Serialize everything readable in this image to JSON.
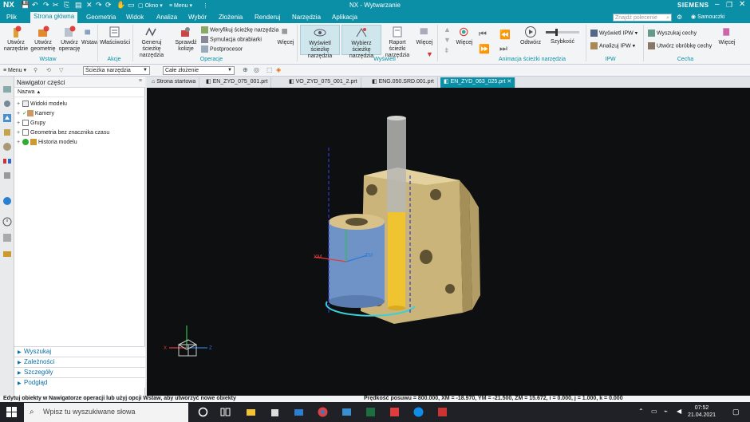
{
  "titlebar": {
    "logo": "NX",
    "title": "NX - Wytwarzanie",
    "window_menu": "Okno",
    "menu": "Menu",
    "brand": "SIEMENS"
  },
  "tabs": [
    "Plik",
    "Strona główna",
    "Geometria",
    "Widok",
    "Analiza",
    "Wybór",
    "Złożenia",
    "Renderuj",
    "Narzędzia",
    "Aplikacja"
  ],
  "active_tab": "Strona główna",
  "search": {
    "placeholder": "Znajdź polecenie"
  },
  "user": "Samouczki",
  "ribbon": {
    "wstaw": {
      "label": "Wstaw",
      "buttons": [
        "Utwórz narzędzie",
        "Utwórz geometrię",
        "Utwórz operację",
        "Wstaw"
      ]
    },
    "akcje": {
      "label": "Akcje",
      "button": "Właściwości"
    },
    "operacje": {
      "label": "Operacje",
      "buttons": [
        "Generuj ścieżkę narzędzia",
        "Sprawdź kolizje"
      ],
      "small": [
        "Weryfikuj ścieżkę narzędzia",
        "Symulacja obrabiarki",
        "Postprocesor"
      ],
      "more": "Więcej"
    },
    "wyswietl": {
      "label": "Wyświetl",
      "buttons": [
        "Wyświetl ścieżkę narzędzia",
        "Wybierz ścieżkę narzędzia",
        "Raport ścieżki narzędzia"
      ],
      "more": "Więcej"
    },
    "animacja": {
      "label": "Animacja ścieżki narzędzia",
      "buttons": [
        "Odtwórz",
        "Szybkość"
      ],
      "speed_level": 0.3
    },
    "ipw": {
      "label": "IPW",
      "small": [
        "Wyświetl IPW",
        "Analizuj IPW"
      ]
    },
    "cecha": {
      "label": "Cecha",
      "small": [
        "Wyszukaj cechy",
        "Utwórz obróbkę cechy"
      ],
      "more": "Więcej"
    }
  },
  "toolbar": {
    "menu": "Menu",
    "filter_value": "Ścieżka narzędzia",
    "scope_value": "Całe złożenie"
  },
  "doc_tabs": [
    {
      "label": "Strona startowa",
      "active": false
    },
    {
      "label": "EN_ZYD_075_001.prt",
      "active": false
    },
    {
      "label": "VO_ZYD_075_001_2.prt",
      "active": false
    },
    {
      "label": "ENG.050.SRD.001.prt",
      "active": false
    },
    {
      "label": "EN_ZYD_063_025.prt",
      "active": true
    }
  ],
  "navigator": {
    "title": "Nawigator części",
    "column": "Nazwa",
    "rows": [
      "Widoki modelu",
      "Kamery",
      "Grupy",
      "Geometria bez znacznika czasu",
      "Historia modelu"
    ],
    "panels": [
      "Wyszukaj",
      "Zależności",
      "Szczegóły",
      "Podgląd"
    ]
  },
  "viewport": {
    "axis_x": "XM",
    "axis_z": "ZM",
    "triad_x": "X",
    "triad_z": "Z"
  },
  "status": {
    "hint": "Edytuj obiekty w Nawigatorze operacji lub użyj opcji Wstaw, aby utworzyć nowe obiekty",
    "feed": "Prędkość posuwu = 800.000, XM = -18.970, YM = -21.500, ZM = 15.672, i = 0.000, j = 1.000, k = 0.000"
  },
  "taskbar": {
    "search_placeholder": "Wpisz tu wyszukiwane słowa",
    "time": "07:52",
    "date": "21.04.2021"
  },
  "colors": {
    "accent": "#0a8fa6",
    "part_body": "#d8c28a",
    "boss": "#6f93c6",
    "tool_yellow": "#f0c330",
    "path_blue": "#2e3bd6",
    "axis_red": "#e03c3c",
    "axis_green": "#2fbf4f"
  }
}
